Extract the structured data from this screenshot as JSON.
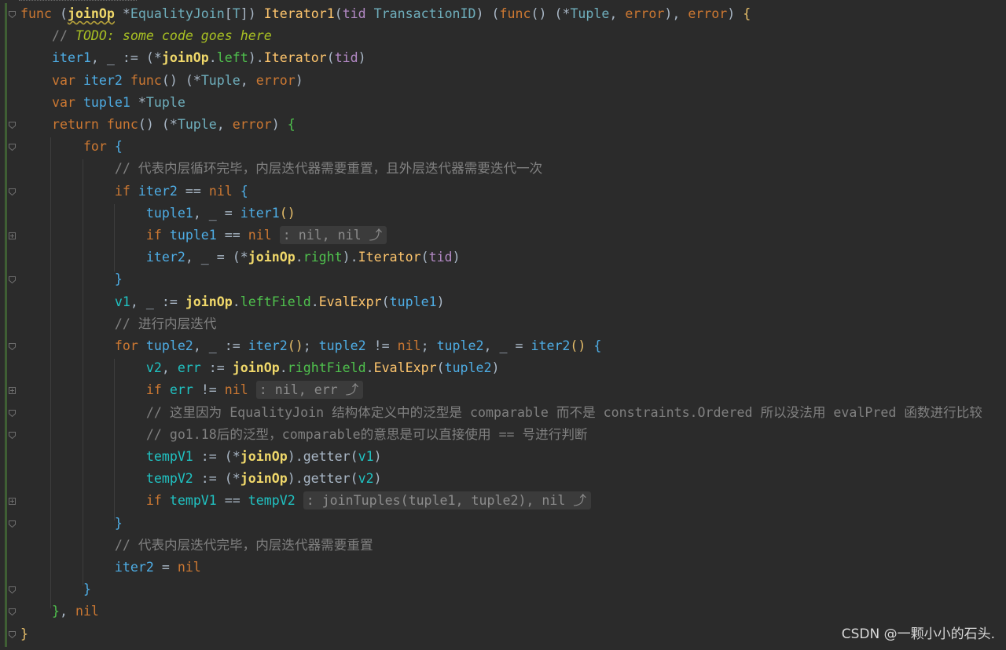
{
  "editor": {
    "language": "go",
    "watermark": "CSDN @一颗小小的石头.",
    "lines": [
      [
        [
          "kw",
          "func "
        ],
        [
          "pun",
          "("
        ],
        [
          "rcv wavy",
          "joinOp"
        ],
        [
          "id",
          " *"
        ],
        [
          "ty",
          "EqualityJoin"
        ],
        [
          "pun",
          "["
        ],
        [
          "ty",
          "T"
        ],
        [
          "pun",
          "]) "
        ],
        [
          "fn",
          "Iterator1"
        ],
        [
          "pun",
          "("
        ],
        [
          "par",
          "tid "
        ],
        [
          "ty",
          "TransactionID"
        ],
        [
          "pun",
          ") ("
        ],
        [
          "kw",
          "func"
        ],
        [
          "pun",
          "() (*"
        ],
        [
          "ty",
          "Tuple"
        ],
        [
          "pun",
          ", "
        ],
        [
          "kw",
          "error"
        ],
        [
          "pun",
          "), "
        ],
        [
          "kw",
          "error"
        ],
        [
          "pun",
          ") "
        ],
        [
          "br",
          "{"
        ]
      ],
      [
        [
          "id",
          "    "
        ],
        [
          "cmt",
          "// "
        ],
        [
          "todo",
          "TODO: some code goes here"
        ]
      ],
      [
        [
          "id",
          "    "
        ],
        [
          "var",
          "iter1"
        ],
        [
          "pun",
          ", _ := (*"
        ],
        [
          "rcv",
          "joinOp"
        ],
        [
          "pun",
          "."
        ],
        [
          "fld",
          "left"
        ],
        [
          "pun",
          ")."
        ],
        [
          "fn",
          "Iterator"
        ],
        [
          "pun",
          "("
        ],
        [
          "par",
          "tid"
        ],
        [
          "pun",
          ")"
        ]
      ],
      [
        [
          "id",
          "    "
        ],
        [
          "kw",
          "var "
        ],
        [
          "var",
          "iter2 "
        ],
        [
          "kw",
          "func"
        ],
        [
          "pun",
          "() (*"
        ],
        [
          "ty",
          "Tuple"
        ],
        [
          "pun",
          ", "
        ],
        [
          "kw",
          "error"
        ],
        [
          "pun",
          ")"
        ]
      ],
      [
        [
          "id",
          "    "
        ],
        [
          "kw",
          "var "
        ],
        [
          "var",
          "tuple1 "
        ],
        [
          "pun",
          "*"
        ],
        [
          "ty",
          "Tuple"
        ]
      ],
      [
        [
          "id",
          "    "
        ],
        [
          "kw",
          "return func"
        ],
        [
          "pun",
          "() (*"
        ],
        [
          "ty",
          "Tuple"
        ],
        [
          "pun",
          ", "
        ],
        [
          "kw",
          "error"
        ],
        [
          "pun",
          ") "
        ],
        [
          "fld",
          "{"
        ]
      ],
      [
        [
          "id",
          "        "
        ],
        [
          "kw",
          "for "
        ],
        [
          "var",
          "{"
        ]
      ],
      [
        [
          "id",
          "            "
        ],
        [
          "cmt",
          "// 代表内层循环完毕，内层迭代器需要重置，且外层迭代器需要迭代一次"
        ]
      ],
      [
        [
          "id",
          "            "
        ],
        [
          "kw",
          "if "
        ],
        [
          "var",
          "iter2 "
        ],
        [
          "pun",
          "== "
        ],
        [
          "kw",
          "nil "
        ],
        [
          "var",
          "{"
        ]
      ],
      [
        [
          "id",
          "                "
        ],
        [
          "var",
          "tuple1"
        ],
        [
          "pun",
          ", _ = "
        ],
        [
          "var",
          "iter1"
        ],
        [
          "br",
          "()"
        ]
      ],
      [
        [
          "id",
          "                "
        ],
        [
          "kw",
          "if "
        ],
        [
          "var",
          "tuple1 "
        ],
        [
          "pun",
          "== "
        ],
        [
          "kw",
          "nil "
        ],
        [
          "hint",
          ": nil, nil ⤴"
        ]
      ],
      [
        [
          "id",
          "                "
        ],
        [
          "var",
          "iter2"
        ],
        [
          "pun",
          ", _ = (*"
        ],
        [
          "rcv",
          "joinOp"
        ],
        [
          "pun",
          "."
        ],
        [
          "fld",
          "right"
        ],
        [
          "pun",
          ")."
        ],
        [
          "fn",
          "Iterator"
        ],
        [
          "pun",
          "("
        ],
        [
          "par",
          "tid"
        ],
        [
          "pun",
          ")"
        ]
      ],
      [
        [
          "id",
          "            "
        ],
        [
          "var",
          "}"
        ]
      ],
      [
        [
          "id",
          "            "
        ],
        [
          "loc",
          "v1"
        ],
        [
          "pun",
          ", _ := "
        ],
        [
          "rcv",
          "joinOp"
        ],
        [
          "pun",
          "."
        ],
        [
          "fld",
          "leftField"
        ],
        [
          "pun",
          "."
        ],
        [
          "fn",
          "EvalExpr"
        ],
        [
          "pun",
          "("
        ],
        [
          "var",
          "tuple1"
        ],
        [
          "pun",
          ")"
        ]
      ],
      [
        [
          "id",
          "            "
        ],
        [
          "cmt",
          "// 进行内层迭代"
        ]
      ],
      [
        [
          "id",
          "            "
        ],
        [
          "kw",
          "for "
        ],
        [
          "var",
          "tuple2"
        ],
        [
          "pun",
          ", _ := "
        ],
        [
          "var",
          "iter2"
        ],
        [
          "br",
          "()"
        ],
        [
          "pun",
          "; "
        ],
        [
          "var",
          "tuple2 "
        ],
        [
          "pun",
          "!= "
        ],
        [
          "kw",
          "nil"
        ],
        [
          "pun",
          "; "
        ],
        [
          "var",
          "tuple2"
        ],
        [
          "pun",
          ", _ = "
        ],
        [
          "var",
          "iter2"
        ],
        [
          "br",
          "() "
        ],
        [
          "var",
          "{"
        ]
      ],
      [
        [
          "id",
          "                "
        ],
        [
          "loc",
          "v2"
        ],
        [
          "pun",
          ", "
        ],
        [
          "loc",
          "err "
        ],
        [
          "pun",
          ":= "
        ],
        [
          "rcv",
          "joinOp"
        ],
        [
          "pun",
          "."
        ],
        [
          "fld",
          "rightField"
        ],
        [
          "pun",
          "."
        ],
        [
          "fn",
          "EvalExpr"
        ],
        [
          "pun",
          "("
        ],
        [
          "var",
          "tuple2"
        ],
        [
          "pun",
          ")"
        ]
      ],
      [
        [
          "id",
          "                "
        ],
        [
          "kw",
          "if "
        ],
        [
          "loc",
          "err "
        ],
        [
          "pun",
          "!= "
        ],
        [
          "kw",
          "nil "
        ],
        [
          "hint",
          ": nil, err ⤴"
        ]
      ],
      [
        [
          "id",
          "                "
        ],
        [
          "cmt",
          "// 这里因为 EqualityJoin 结构体定义中的泛型是 comparable 而不是 constraints.Ordered 所以没法用 evalPred 函数进行比较"
        ]
      ],
      [
        [
          "id",
          "                "
        ],
        [
          "cmt",
          "// go1.18后的泛型，comparable的意思是可以直接使用 == 号进行判断"
        ]
      ],
      [
        [
          "id",
          "                "
        ],
        [
          "loc",
          "tempV1 "
        ],
        [
          "pun",
          ":= (*"
        ],
        [
          "rcv",
          "joinOp"
        ],
        [
          "pun",
          ")."
        ],
        [
          "id",
          "getter"
        ],
        [
          "pun",
          "("
        ],
        [
          "loc",
          "v1"
        ],
        [
          "pun",
          ")"
        ]
      ],
      [
        [
          "id",
          "                "
        ],
        [
          "loc",
          "tempV2 "
        ],
        [
          "pun",
          ":= (*"
        ],
        [
          "rcv",
          "joinOp"
        ],
        [
          "pun",
          ")."
        ],
        [
          "id",
          "getter"
        ],
        [
          "pun",
          "("
        ],
        [
          "loc",
          "v2"
        ],
        [
          "pun",
          ")"
        ]
      ],
      [
        [
          "id",
          "                "
        ],
        [
          "kw",
          "if "
        ],
        [
          "loc",
          "tempV1 "
        ],
        [
          "pun",
          "== "
        ],
        [
          "loc",
          "tempV2 "
        ],
        [
          "hint",
          ": joinTuples(tuple1, tuple2), nil ⤴"
        ]
      ],
      [
        [
          "id",
          "            "
        ],
        [
          "var",
          "}"
        ]
      ],
      [
        [
          "id",
          "            "
        ],
        [
          "cmt",
          "// 代表内层迭代完毕，内层迭代器需要重置"
        ]
      ],
      [
        [
          "id",
          "            "
        ],
        [
          "var",
          "iter2 "
        ],
        [
          "pun",
          "= "
        ],
        [
          "kw",
          "nil"
        ]
      ],
      [
        [
          "id",
          "        "
        ],
        [
          "var",
          "}"
        ]
      ],
      [
        [
          "id",
          "    "
        ],
        [
          "fld",
          "}"
        ],
        [
          "pun",
          ", "
        ],
        [
          "kw",
          "nil"
        ]
      ],
      [
        [
          "br",
          "}"
        ]
      ]
    ]
  }
}
